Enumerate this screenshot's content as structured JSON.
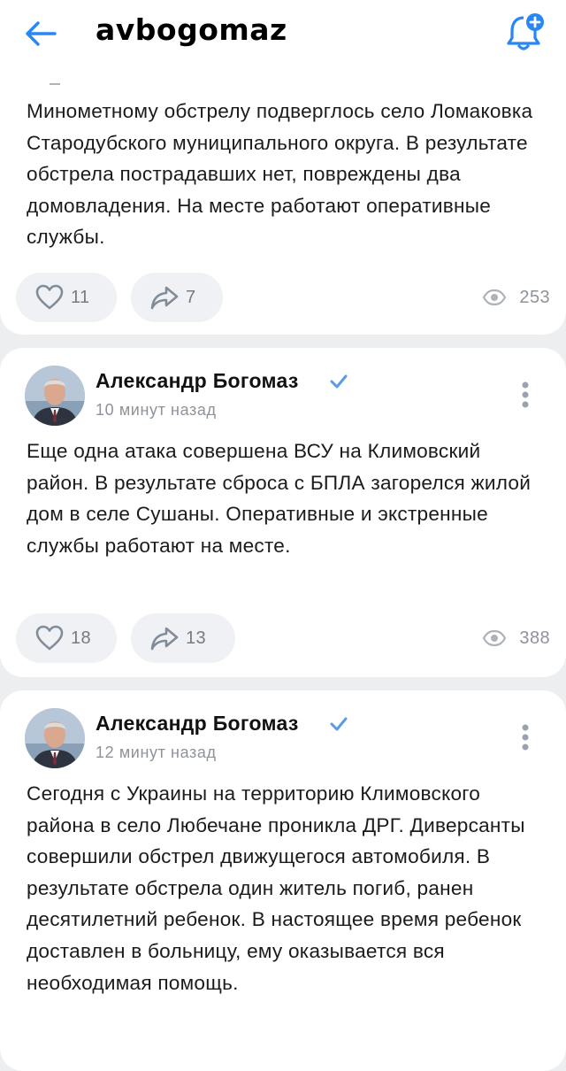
{
  "header": {
    "title": "avbogomaz",
    "back_icon": "arrow-left-icon",
    "bell_icon": "bell-plus-icon",
    "accent": "#2787f5"
  },
  "posts": [
    {
      "text": "Минометному обстрелу подверглось село Ломаковка Стародубского муниципального округа. В результате обстрела пострадавших нет, повреждены два домовладения. На месте работают оперативные службы.",
      "likes": "11",
      "shares": "7",
      "views": "253"
    },
    {
      "author": "Александр Богомаз",
      "time": "10 минут назад",
      "text": "Еще одна атака совершена ВСУ на Климовский район. В результате сброса с БПЛА загорелся жилой дом в селе Сушаны. Оперативные и экстренные службы работают на месте.",
      "likes": "18",
      "shares": "13",
      "views": "388"
    },
    {
      "author": "Александр Богомаз",
      "time": "12 минут назад",
      "text": "Сегодня с Украины на территорию Климовского района в село Любечане проникла ДРГ. Диверсанты совершили обстрел движущегося автомобиля. В результате обстрела один житель погиб, ранен десятилетний ребенок. В настоящее время ребенок доставлен в больницу, ему оказывается вся необходимая помощь."
    }
  ]
}
